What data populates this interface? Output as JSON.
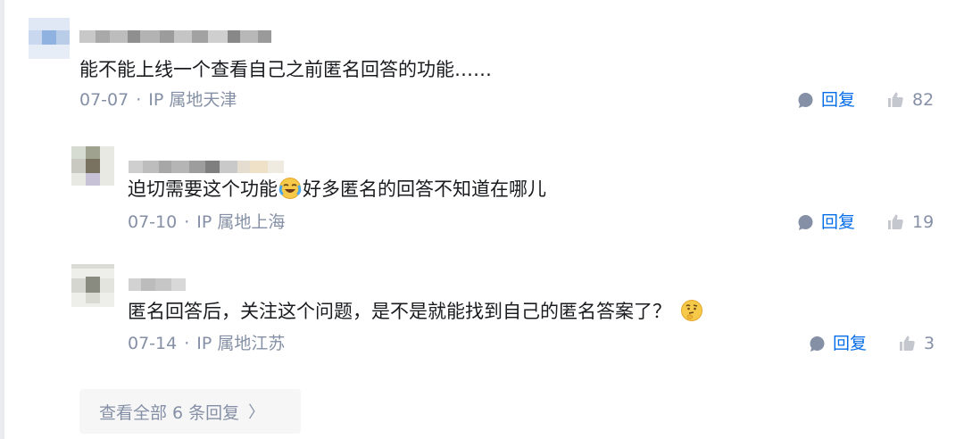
{
  "comments": [
    {
      "content": "能不能上线一个查看自己之前匿名回答的功能……",
      "date": "07-07",
      "location": "IP 属地天津",
      "reply_label": "回复",
      "likes": "82",
      "emoji": null
    },
    {
      "content_before": "迫切需要这个功能",
      "emoji": "laugh-cry-emoji",
      "content_after": "好多匿名的回答不知道在哪儿",
      "date": "07-10",
      "location": "IP 属地上海",
      "reply_label": "回复",
      "likes": "19"
    },
    {
      "content": "匿名回答后，关注这个问题，是不是就能找到自己的匿名答案了？",
      "emoji": "thinking-emoji",
      "date": "07-14",
      "location": "IP 属地江苏",
      "reply_label": "回复",
      "likes": "3"
    }
  ],
  "meta_separator": "·",
  "view_all_label": "查看全部 6 条回复",
  "view_all_chevron": "〉",
  "colors": {
    "accent": "#056de8",
    "meta": "#8590a6",
    "icon_gray": "#8590a6",
    "like_gray": "#c4c7ce",
    "button_bg": "#f6f6f6"
  }
}
